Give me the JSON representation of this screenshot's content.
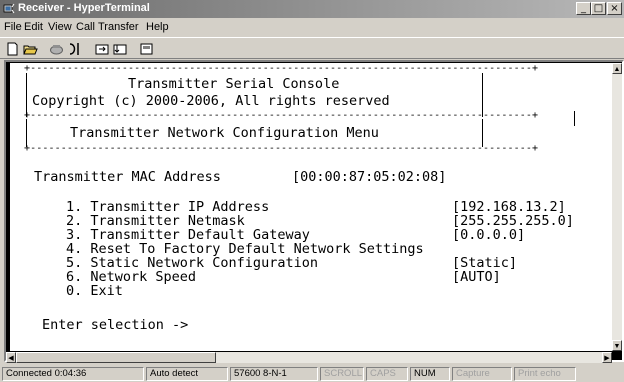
{
  "window": {
    "title": "Receiver - HyperTerminal",
    "controls": [
      "_",
      "□",
      "×"
    ]
  },
  "menu": [
    "File",
    "Edit",
    "View",
    "Call",
    "Transfer",
    "Help"
  ],
  "toolbar_icons": [
    "new-icon",
    "open-icon",
    "connect-icon",
    "disconnect-icon",
    "send-icon",
    "receive-icon",
    "properties-icon"
  ],
  "terminal": {
    "header_title": "Transmitter Serial Console",
    "header_copyright": "Copyright (c) 2000-2006, All rights reserved",
    "menu_title": "Transmitter Network Configuration Menu",
    "mac_label": "Transmitter MAC Address",
    "mac_value": "[00:00:87:05:02:08]",
    "options": [
      {
        "text": "1. Transmitter IP Address",
        "value": "[192.168.13.2]"
      },
      {
        "text": "2. Transmitter Netmask",
        "value": "[255.255.255.0]"
      },
      {
        "text": "3. Transmitter Default Gateway",
        "value": "[0.0.0.0]"
      },
      {
        "text": "4. Reset To Factory Default Network Settings",
        "value": ""
      },
      {
        "text": "5. Static Network Configuration",
        "value": "[Static]"
      },
      {
        "text": "6. Network Speed",
        "value": "[AUTO]"
      },
      {
        "text": "0. Exit",
        "value": ""
      }
    ],
    "prompt": "Enter selection ->"
  },
  "status": {
    "connected": "Connected 0:04:36",
    "detect": "Auto detect",
    "port": "57600 8-N-1",
    "scroll": "SCROLL",
    "caps": "CAPS",
    "num": "NUM",
    "capture": "Capture",
    "print_echo": "Print echo"
  }
}
